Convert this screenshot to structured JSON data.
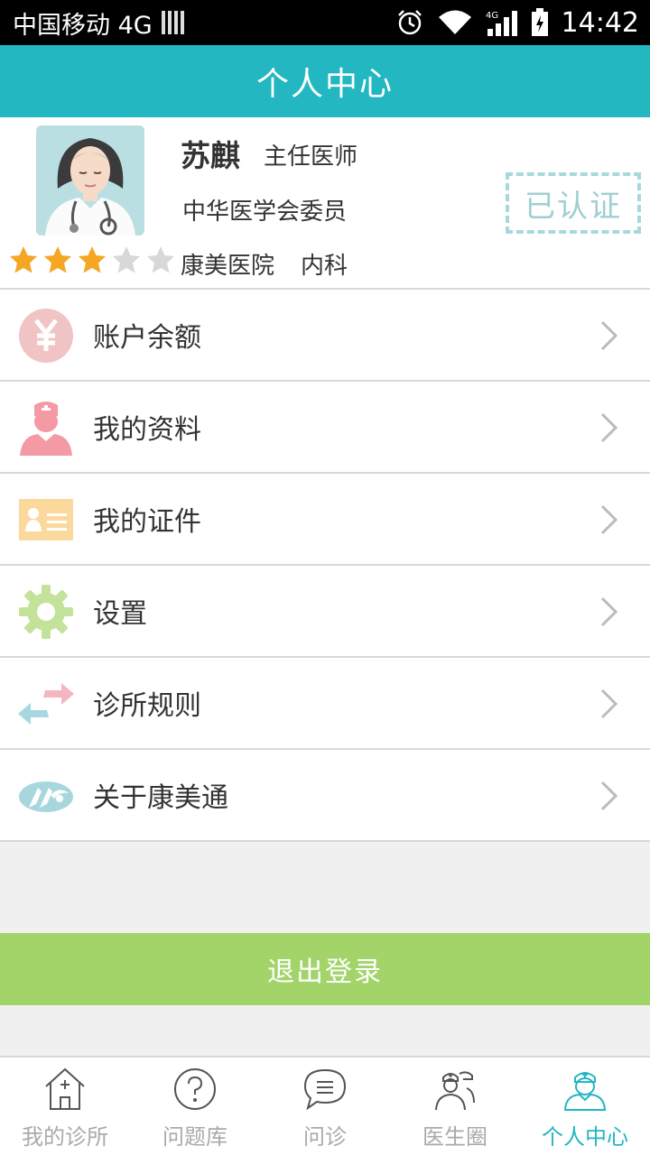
{
  "status_bar": {
    "carrier": "中国移动 4G",
    "network": "4G",
    "time": "14:42"
  },
  "header": {
    "title": "个人中心"
  },
  "profile": {
    "name": "苏麒",
    "title": "主任医师",
    "organization": "中华医学会委员",
    "hospital": "康美医院",
    "department": "内科",
    "rating": 3,
    "rating_max": 5,
    "verified_label": "已认证"
  },
  "menu": {
    "items": [
      {
        "label": "账户余额",
        "icon": "yen-icon"
      },
      {
        "label": "我的资料",
        "icon": "nurse-profile-icon"
      },
      {
        "label": "我的证件",
        "icon": "id-card-icon"
      },
      {
        "label": "设置",
        "icon": "gear-icon"
      },
      {
        "label": "诊所规则",
        "icon": "exchange-arrows-icon"
      },
      {
        "label": "关于康美通",
        "icon": "brand-logo-icon"
      }
    ]
  },
  "logout_label": "退出登录",
  "bottom_nav": {
    "items": [
      {
        "label": "我的诊所",
        "icon": "home-clinic-icon",
        "active": false
      },
      {
        "label": "问题库",
        "icon": "question-icon",
        "active": false
      },
      {
        "label": "问诊",
        "icon": "chat-bubble-icon",
        "active": false
      },
      {
        "label": "医生圈",
        "icon": "doctors-group-icon",
        "active": false
      },
      {
        "label": "个人中心",
        "icon": "doctor-person-icon",
        "active": true
      }
    ]
  },
  "colors": {
    "primary": "#22b7c1",
    "logout": "#a2d46a",
    "star_on": "#f5a623",
    "star_off": "#d8d8d8"
  }
}
